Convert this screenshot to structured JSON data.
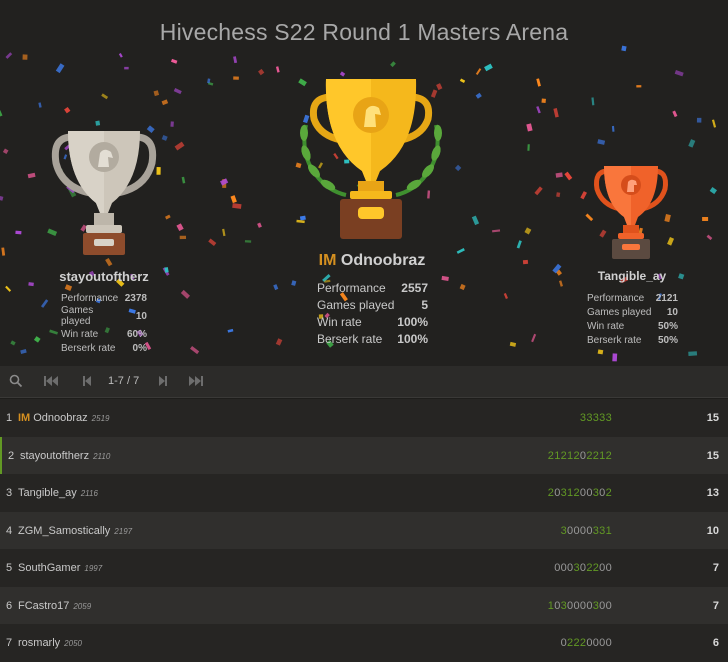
{
  "title": "Hivechess S22 Round 1 Masters Arena",
  "podium": {
    "first": {
      "title": "IM",
      "name": "Odnoobraz",
      "stats": [
        {
          "label": "Performance",
          "value": "2557"
        },
        {
          "label": "Games played",
          "value": "5"
        },
        {
          "label": "Win rate",
          "value": "100%"
        },
        {
          "label": "Berserk rate",
          "value": "100%"
        }
      ]
    },
    "second": {
      "name": "stayoutoftherz",
      "stats": [
        {
          "label": "Performance",
          "value": "2378"
        },
        {
          "label": "Games played",
          "value": "10"
        },
        {
          "label": "Win rate",
          "value": "60%"
        },
        {
          "label": "Berserk rate",
          "value": "0%"
        }
      ]
    },
    "third": {
      "name": "Tangible_ay",
      "stats": [
        {
          "label": "Performance",
          "value": "2121"
        },
        {
          "label": "Games played",
          "value": "10"
        },
        {
          "label": "Win rate",
          "value": "50%"
        },
        {
          "label": "Berserk rate",
          "value": "50%"
        }
      ]
    }
  },
  "pager": {
    "info": "1-7 / 7",
    "icons": [
      "search-icon",
      "first-page-icon",
      "prev-page-icon",
      "next-page-icon",
      "last-page-icon"
    ]
  },
  "colors": {
    "accent_green": "#629924",
    "title_gold": "#d59020"
  },
  "standings": [
    {
      "rank": "1",
      "title": "IM",
      "name": "Odnoobraz",
      "rating": "2519",
      "sheet": "33333",
      "score": "15"
    },
    {
      "rank": "2",
      "title": "",
      "name": "stayoutoftherz",
      "rating": "2110",
      "sheet": "2121202212",
      "score": "15",
      "me": true
    },
    {
      "rank": "3",
      "title": "",
      "name": "Tangible_ay",
      "rating": "2116",
      "sheet": "2031200302",
      "score": "13"
    },
    {
      "rank": "4",
      "title": "",
      "name": "ZGM_Samostically",
      "rating": "2197",
      "sheet": "30000331",
      "score": "10"
    },
    {
      "rank": "5",
      "title": "",
      "name": "SouthGamer",
      "rating": "1997",
      "sheet": "000302200",
      "score": "7"
    },
    {
      "rank": "6",
      "title": "",
      "name": "FCastro17",
      "rating": "2059",
      "sheet": "1030000300",
      "score": "7"
    },
    {
      "rank": "7",
      "title": "",
      "name": "rosmarly",
      "rating": "2050",
      "sheet": "02220000",
      "score": "6"
    }
  ]
}
